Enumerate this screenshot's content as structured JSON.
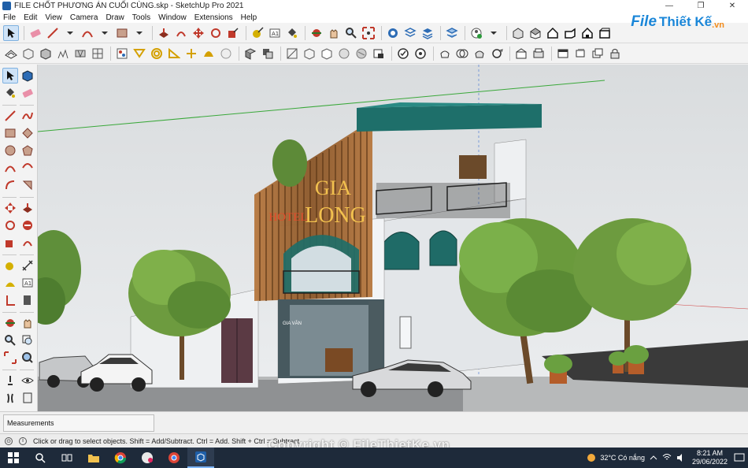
{
  "window": {
    "title": "FILE CHỐT PHƯƠNG ÁN CUỐI CÙNG.skp - SketchUp Pro 2021",
    "minimize": "—",
    "maximize": "❐",
    "close": "✕"
  },
  "menu": [
    "File",
    "Edit",
    "View",
    "Camera",
    "Draw",
    "Tools",
    "Window",
    "Extensions",
    "Help"
  ],
  "watermark_logo": {
    "file": "File",
    "rest": "Thiết Kế",
    "vn": ".vn"
  },
  "viewport": {
    "sign_top": "GIA",
    "sign_bottom": "LONG",
    "sign_left": "HOTEL",
    "sign_side": "GIA VĂN"
  },
  "measurements": {
    "label": "Measurements",
    "value": ""
  },
  "status": {
    "text": "Click or drag to select objects. Shift = Add/Subtract. Ctrl = Add. Shift + Ctrl = Subtract."
  },
  "copyright": "Copyright © FileThietKe.vn",
  "taskbar": {
    "weather": "32°C  Có nắng",
    "time": "8:21 AM",
    "date": "29/06/2022"
  },
  "colors": {
    "accent": "#1a86d8",
    "teal": "#1e6f6a",
    "wood": "#a96b35",
    "taskbar": "#1e2a3a"
  }
}
